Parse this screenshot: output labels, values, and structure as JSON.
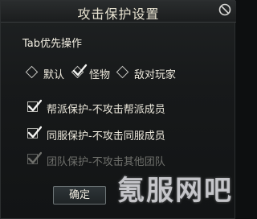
{
  "window": {
    "title": "攻击保护设置",
    "close_icon": "no-entry-circle-icon"
  },
  "tab_section": {
    "title": "Tab优先操作",
    "options": [
      {
        "label": "默认",
        "selected": false
      },
      {
        "label": "怪物",
        "selected": true
      },
      {
        "label": "敌对玩家",
        "selected": false
      }
    ]
  },
  "protections": [
    {
      "label": "帮派保护-不攻击帮派成员",
      "checked": true,
      "enabled": true
    },
    {
      "label": "同服保护-不攻击同服成员",
      "checked": true,
      "enabled": true
    },
    {
      "label": "团队保护-不攻击其他团队",
      "checked": true,
      "enabled": false
    }
  ],
  "buttons": {
    "confirm_label": "确定"
  },
  "watermark": {
    "text": "氪服网吧"
  }
}
